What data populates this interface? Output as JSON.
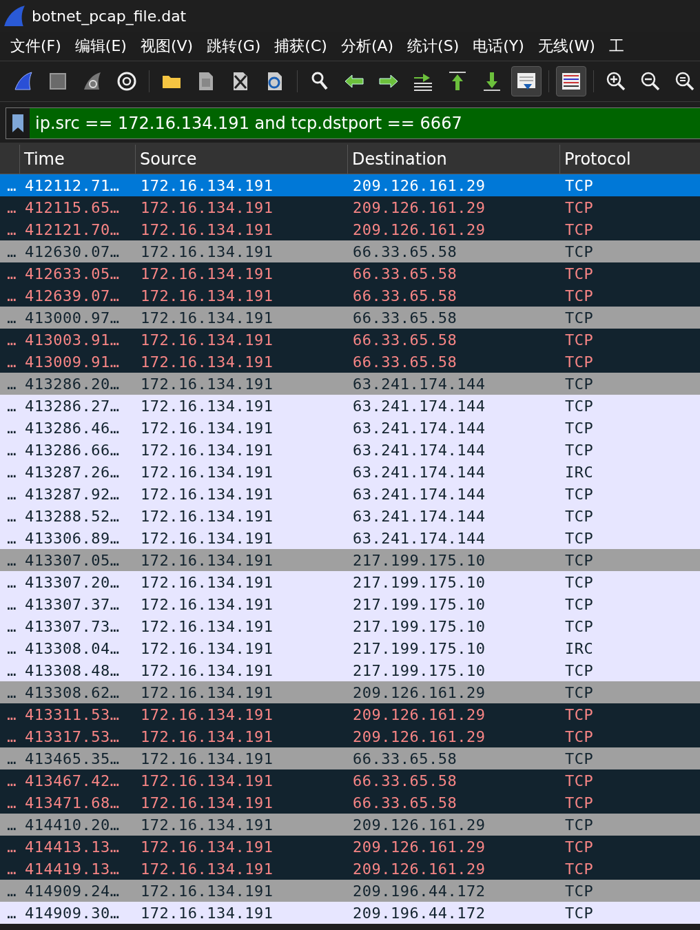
{
  "window": {
    "title": "botnet_pcap_file.dat"
  },
  "menu": [
    "文件(F)",
    "编辑(E)",
    "视图(V)",
    "跳转(G)",
    "捕获(C)",
    "分析(A)",
    "统计(S)",
    "电话(Y)",
    "无线(W)",
    "工"
  ],
  "toolbar": [
    [
      {
        "kind": "start",
        "on": false
      },
      {
        "kind": "stop",
        "on": false
      },
      {
        "kind": "restart",
        "on": false
      },
      {
        "kind": "options",
        "on": false
      }
    ],
    [
      {
        "kind": "open",
        "on": false
      },
      {
        "kind": "save",
        "on": false
      },
      {
        "kind": "close",
        "on": false
      },
      {
        "kind": "reload",
        "on": false
      }
    ],
    [
      {
        "kind": "find",
        "on": false
      },
      {
        "kind": "back",
        "on": false
      },
      {
        "kind": "forward",
        "on": false
      },
      {
        "kind": "goto",
        "on": false
      },
      {
        "kind": "first",
        "on": false
      },
      {
        "kind": "last",
        "on": false
      },
      {
        "kind": "autoscroll",
        "on": true
      }
    ],
    [
      {
        "kind": "colorize",
        "on": true
      }
    ],
    [
      {
        "kind": "zoomin",
        "on": false
      },
      {
        "kind": "zoomout",
        "on": false
      },
      {
        "kind": "zoomreset",
        "on": false
      }
    ]
  ],
  "filter": {
    "value": "ip.src == 172.16.134.191 and tcp.dstport == 6667"
  },
  "table": {
    "columns": [
      "",
      "Time",
      "Source",
      "Destination",
      "Protocol"
    ],
    "rows": [
      {
        "kind": "normal",
        "selected": true,
        "cells": [
          "…",
          "412112.71…",
          "172.16.134.191",
          "209.126.161.29",
          "TCP"
        ]
      },
      {
        "kind": "dark",
        "selected": false,
        "cells": [
          "…",
          "412115.65…",
          "172.16.134.191",
          "209.126.161.29",
          "TCP"
        ]
      },
      {
        "kind": "dark",
        "selected": false,
        "cells": [
          "…",
          "412121.70…",
          "172.16.134.191",
          "209.126.161.29",
          "TCP"
        ]
      },
      {
        "kind": "gray",
        "selected": false,
        "cells": [
          "…",
          "412630.07…",
          "172.16.134.191",
          "66.33.65.58",
          "TCP"
        ]
      },
      {
        "kind": "dark",
        "selected": false,
        "cells": [
          "…",
          "412633.05…",
          "172.16.134.191",
          "66.33.65.58",
          "TCP"
        ]
      },
      {
        "kind": "dark",
        "selected": false,
        "cells": [
          "…",
          "412639.07…",
          "172.16.134.191",
          "66.33.65.58",
          "TCP"
        ]
      },
      {
        "kind": "gray",
        "selected": false,
        "cells": [
          "…",
          "413000.97…",
          "172.16.134.191",
          "66.33.65.58",
          "TCP"
        ]
      },
      {
        "kind": "dark",
        "selected": false,
        "cells": [
          "…",
          "413003.91…",
          "172.16.134.191",
          "66.33.65.58",
          "TCP"
        ]
      },
      {
        "kind": "dark",
        "selected": false,
        "cells": [
          "…",
          "413009.91…",
          "172.16.134.191",
          "66.33.65.58",
          "TCP"
        ]
      },
      {
        "kind": "gray",
        "selected": false,
        "cells": [
          "…",
          "413286.20…",
          "172.16.134.191",
          "63.241.174.144",
          "TCP"
        ]
      },
      {
        "kind": "light",
        "selected": false,
        "cells": [
          "…",
          "413286.27…",
          "172.16.134.191",
          "63.241.174.144",
          "TCP"
        ]
      },
      {
        "kind": "light",
        "selected": false,
        "cells": [
          "…",
          "413286.46…",
          "172.16.134.191",
          "63.241.174.144",
          "TCP"
        ]
      },
      {
        "kind": "light",
        "selected": false,
        "cells": [
          "…",
          "413286.66…",
          "172.16.134.191",
          "63.241.174.144",
          "TCP"
        ]
      },
      {
        "kind": "light",
        "selected": false,
        "cells": [
          "…",
          "413287.26…",
          "172.16.134.191",
          "63.241.174.144",
          "IRC"
        ]
      },
      {
        "kind": "light",
        "selected": false,
        "cells": [
          "…",
          "413287.92…",
          "172.16.134.191",
          "63.241.174.144",
          "TCP"
        ]
      },
      {
        "kind": "light",
        "selected": false,
        "cells": [
          "…",
          "413288.52…",
          "172.16.134.191",
          "63.241.174.144",
          "TCP"
        ]
      },
      {
        "kind": "light",
        "selected": false,
        "cells": [
          "…",
          "413306.89…",
          "172.16.134.191",
          "63.241.174.144",
          "TCP"
        ]
      },
      {
        "kind": "gray",
        "selected": false,
        "cells": [
          "…",
          "413307.05…",
          "172.16.134.191",
          "217.199.175.10",
          "TCP"
        ]
      },
      {
        "kind": "light",
        "selected": false,
        "cells": [
          "…",
          "413307.20…",
          "172.16.134.191",
          "217.199.175.10",
          "TCP"
        ]
      },
      {
        "kind": "light",
        "selected": false,
        "cells": [
          "…",
          "413307.37…",
          "172.16.134.191",
          "217.199.175.10",
          "TCP"
        ]
      },
      {
        "kind": "light",
        "selected": false,
        "cells": [
          "…",
          "413307.73…",
          "172.16.134.191",
          "217.199.175.10",
          "TCP"
        ]
      },
      {
        "kind": "light",
        "selected": false,
        "cells": [
          "…",
          "413308.04…",
          "172.16.134.191",
          "217.199.175.10",
          "IRC"
        ]
      },
      {
        "kind": "light",
        "selected": false,
        "cells": [
          "…",
          "413308.48…",
          "172.16.134.191",
          "217.199.175.10",
          "TCP"
        ]
      },
      {
        "kind": "gray",
        "selected": false,
        "cells": [
          "…",
          "413308.62…",
          "172.16.134.191",
          "209.126.161.29",
          "TCP"
        ]
      },
      {
        "kind": "dark",
        "selected": false,
        "cells": [
          "…",
          "413311.53…",
          "172.16.134.191",
          "209.126.161.29",
          "TCP"
        ]
      },
      {
        "kind": "dark",
        "selected": false,
        "cells": [
          "…",
          "413317.53…",
          "172.16.134.191",
          "209.126.161.29",
          "TCP"
        ]
      },
      {
        "kind": "gray",
        "selected": false,
        "cells": [
          "…",
          "413465.35…",
          "172.16.134.191",
          "66.33.65.58",
          "TCP"
        ]
      },
      {
        "kind": "dark",
        "selected": false,
        "cells": [
          "…",
          "413467.42…",
          "172.16.134.191",
          "66.33.65.58",
          "TCP"
        ]
      },
      {
        "kind": "dark",
        "selected": false,
        "cells": [
          "…",
          "413471.68…",
          "172.16.134.191",
          "66.33.65.58",
          "TCP"
        ]
      },
      {
        "kind": "gray",
        "selected": false,
        "cells": [
          "…",
          "414410.20…",
          "172.16.134.191",
          "209.126.161.29",
          "TCP"
        ]
      },
      {
        "kind": "dark",
        "selected": false,
        "cells": [
          "…",
          "414413.13…",
          "172.16.134.191",
          "209.126.161.29",
          "TCP"
        ]
      },
      {
        "kind": "dark",
        "selected": false,
        "cells": [
          "…",
          "414419.13…",
          "172.16.134.191",
          "209.126.161.29",
          "TCP"
        ]
      },
      {
        "kind": "gray",
        "selected": false,
        "cells": [
          "…",
          "414909.24…",
          "172.16.134.191",
          "209.196.44.172",
          "TCP"
        ]
      },
      {
        "kind": "light",
        "selected": false,
        "cells": [
          "…",
          "414909.30…",
          "172.16.134.191",
          "209.196.44.172",
          "TCP"
        ]
      }
    ]
  }
}
